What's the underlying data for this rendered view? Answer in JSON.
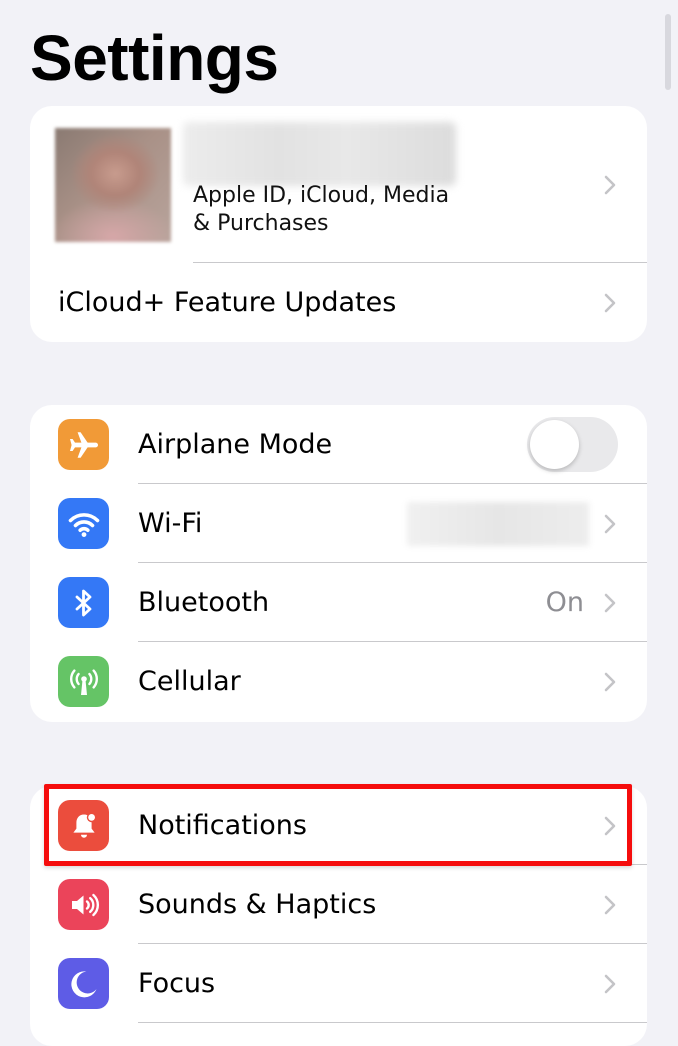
{
  "title": "Settings",
  "profile": {
    "subtitle_line1": "Apple ID, iCloud, Media",
    "subtitle_line2": "& Purchases",
    "feature_updates_label": "iCloud+ Feature Updates"
  },
  "connectivity": {
    "airplane_mode": {
      "label": "Airplane Mode",
      "icon": "airplane-icon",
      "color": "#f19a37",
      "toggle_on": false
    },
    "wifi": {
      "label": "Wi-Fi",
      "icon": "wifi-icon",
      "color": "#3478f6"
    },
    "bluetooth": {
      "label": "Bluetooth",
      "icon": "bluetooth-icon",
      "color": "#3478f6",
      "value": "On"
    },
    "cellular": {
      "label": "Cellular",
      "icon": "cellular-antenna-icon",
      "color": "#65c466"
    }
  },
  "alerts": {
    "notifications": {
      "label": "Notifications",
      "icon": "notification-bell-icon",
      "color": "#eb4d3d"
    },
    "sounds": {
      "label": "Sounds & Haptics",
      "icon": "speaker-icon",
      "color": "#eb445a"
    },
    "focus": {
      "label": "Focus",
      "icon": "moon-icon",
      "color": "#5e5ce6"
    }
  },
  "highlight": {
    "color": "#f50d0d",
    "target": "Notifications"
  }
}
